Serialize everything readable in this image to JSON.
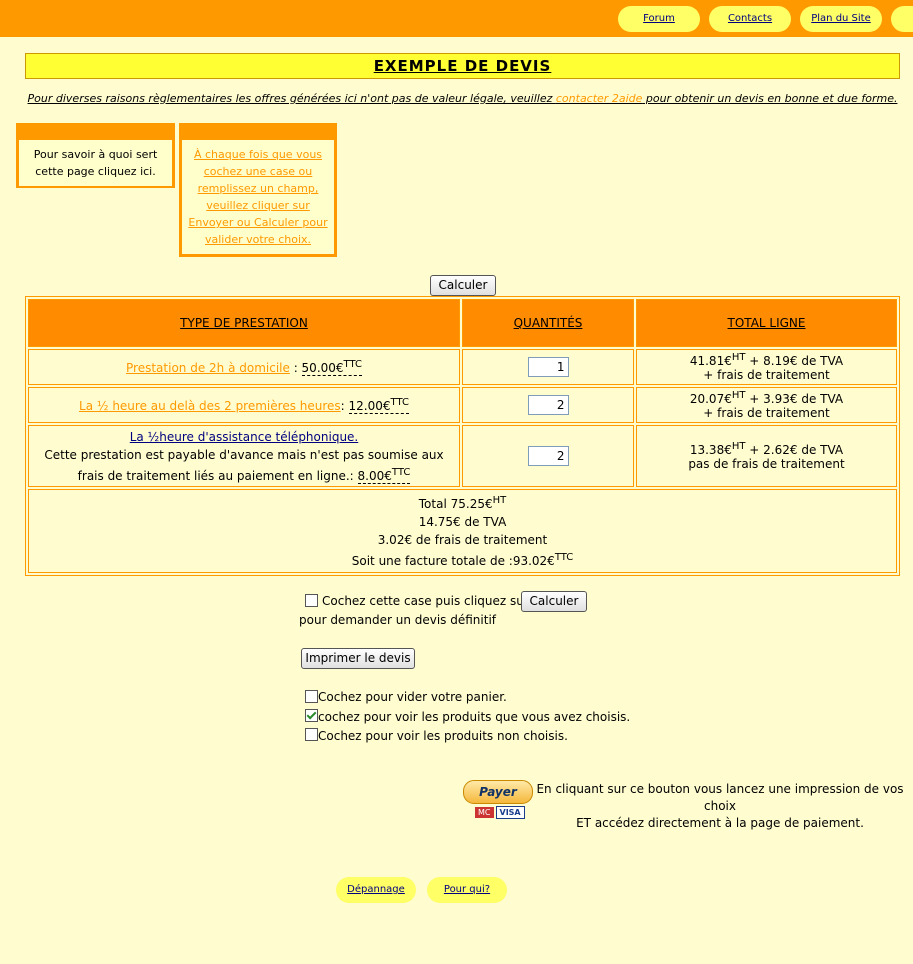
{
  "nav": {
    "forum": "Forum",
    "contacts": "Contacts",
    "plan": "Plan du Site"
  },
  "title": "EXEMPLE DE DEVIS",
  "notice": {
    "before": "Pour diverses raisons règlementaires les offres générées ici n'ont pas de valeur légale, veuillez ",
    "link": "contacter 2aide",
    "after": " pour obtenir un devis en bonne et due forme."
  },
  "info_box": "Pour savoir à quoi sert cette page cliquez ici.",
  "help_box": "À chaque fois que vous cochez une case ou remplissez un champ, veuillez cliquer sur Envoyer ou Calculer pour valider votre choix.",
  "calc_label": "Calculer",
  "table": {
    "headers": [
      "TYPE DE PRESTATION",
      "QUANTITÉS",
      "TOTAL LIGNE"
    ],
    "rows": [
      {
        "name": "Prestation de 2h à domicile",
        "sep": " : ",
        "price": "50.00€",
        "sup": "TTC",
        "qty": "1",
        "total_a": "41.81€",
        "total_sup": "HT",
        "total_b": " + 8.19€ de TVA",
        "total_c": "+ frais de traitement"
      },
      {
        "name": "La ½ heure au delà des 2 premières heures",
        "sep": ": ",
        "price": "12.00€",
        "sup": "TTC",
        "qty": "2",
        "total_a": "20.07€",
        "total_sup": "HT",
        "total_b": " + 3.93€ de TVA",
        "total_c": "+ frais de traitement"
      },
      {
        "name": "La ½heure d'assistance téléphonique.",
        "desc": "Cette prestation est payable d'avance mais n'est pas soumise aux frais de traitement liés au paiement en ligne.: ",
        "price": "8.00€",
        "sup": "TTC",
        "qty": "2",
        "total_a": "13.38€",
        "total_sup": "HT",
        "total_b": " + 2.62€ de TVA",
        "total_c": "pas de frais de traitement"
      }
    ],
    "summary": {
      "total": "Total 75.25€",
      "total_sup": "HT",
      "tva": "14.75€ de TVA",
      "frais": "3.02€ de frais de traitement",
      "facture": "Soit une facture totale de :93.02€",
      "facture_sup": "TTC"
    }
  },
  "devis_check": {
    "label": "Cochez cette case puis cliquez sur",
    "button": "Calculer",
    "label2": "pour demander un devis définitif"
  },
  "print_label": "Imprimer le devis",
  "options": [
    {
      "label": "Cochez pour vider votre panier.",
      "checked": false
    },
    {
      "label": "cochez pour voir les produits que vous avez choisis.",
      "checked": true
    },
    {
      "label": "Cochez pour voir les produits non choisis.",
      "checked": false
    }
  ],
  "paypal": {
    "button": "Payer",
    "text1": "En cliquant sur ce bouton vous lancez une impression de vos choix",
    "text2": "ET accédez directement à la page de paiement.",
    "card1": "MC",
    "card2": "VISA"
  },
  "footer": {
    "depannage": "Dépannage",
    "pourqui": "Pour qui?"
  }
}
